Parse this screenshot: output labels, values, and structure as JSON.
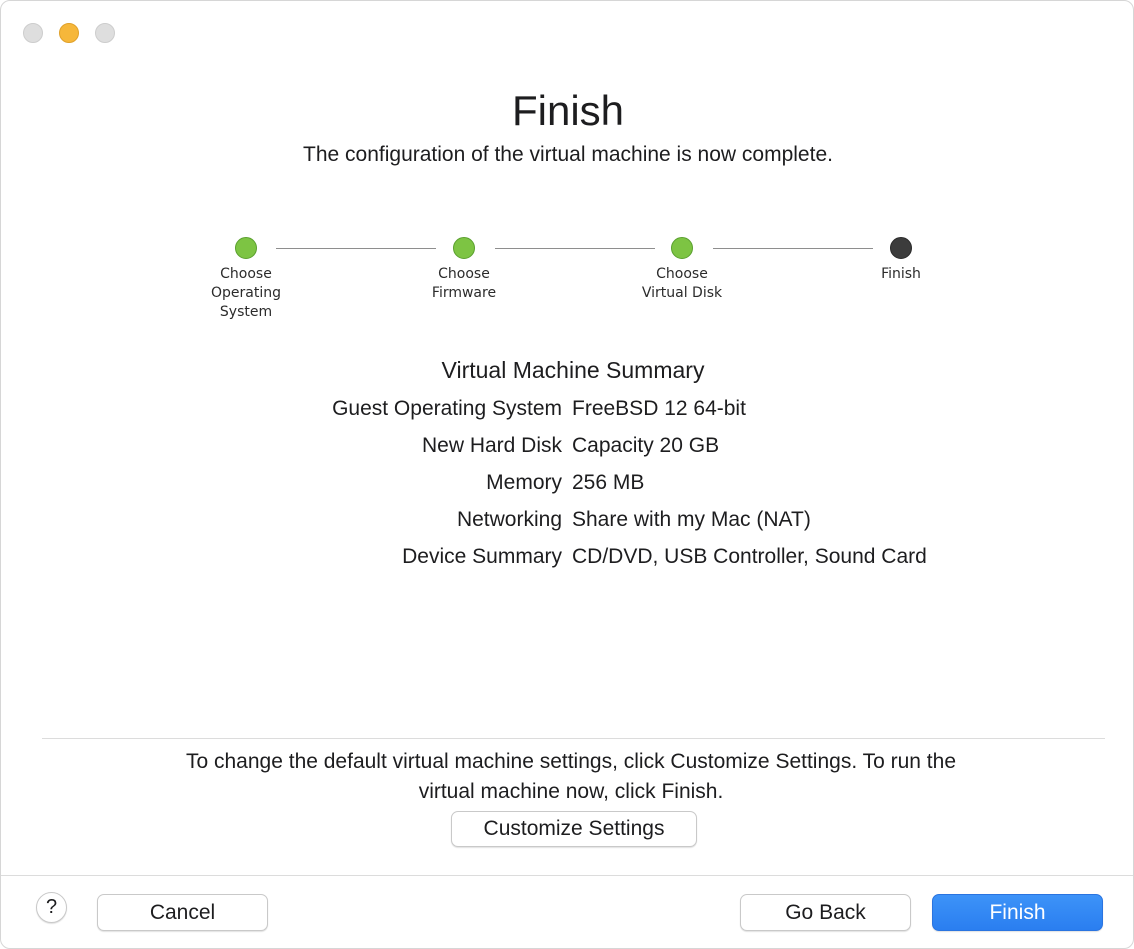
{
  "window": {
    "title": "Finish",
    "subtitle": "The configuration of the virtual machine is now complete."
  },
  "stepper": {
    "steps": [
      {
        "label": "Choose\nOperating\nSystem",
        "state": "done"
      },
      {
        "label": "Choose\nFirmware",
        "state": "done"
      },
      {
        "label": "Choose\nVirtual Disk",
        "state": "done"
      },
      {
        "label": "Finish",
        "state": "current"
      }
    ]
  },
  "summary": {
    "title": "Virtual Machine Summary",
    "rows": [
      {
        "key": "Guest Operating System",
        "value": "FreeBSD 12 64-bit"
      },
      {
        "key": "New Hard Disk",
        "value": "Capacity 20 GB"
      },
      {
        "key": "Memory",
        "value": "256 MB"
      },
      {
        "key": "Networking",
        "value": "Share with my Mac (NAT)"
      },
      {
        "key": "Device Summary",
        "value": "CD/DVD, USB Controller, Sound Card"
      }
    ]
  },
  "info": {
    "line1": "To change the default virtual machine settings, click Customize Settings. To run the",
    "line2": "virtual machine now, click Finish."
  },
  "buttons": {
    "customize": "Customize Settings",
    "help": "?",
    "cancel": "Cancel",
    "go_back": "Go Back",
    "finish": "Finish"
  },
  "colors": {
    "step_done": "#7dc443",
    "step_current": "#3c3c3c",
    "primary_button": "#2f86f4"
  }
}
